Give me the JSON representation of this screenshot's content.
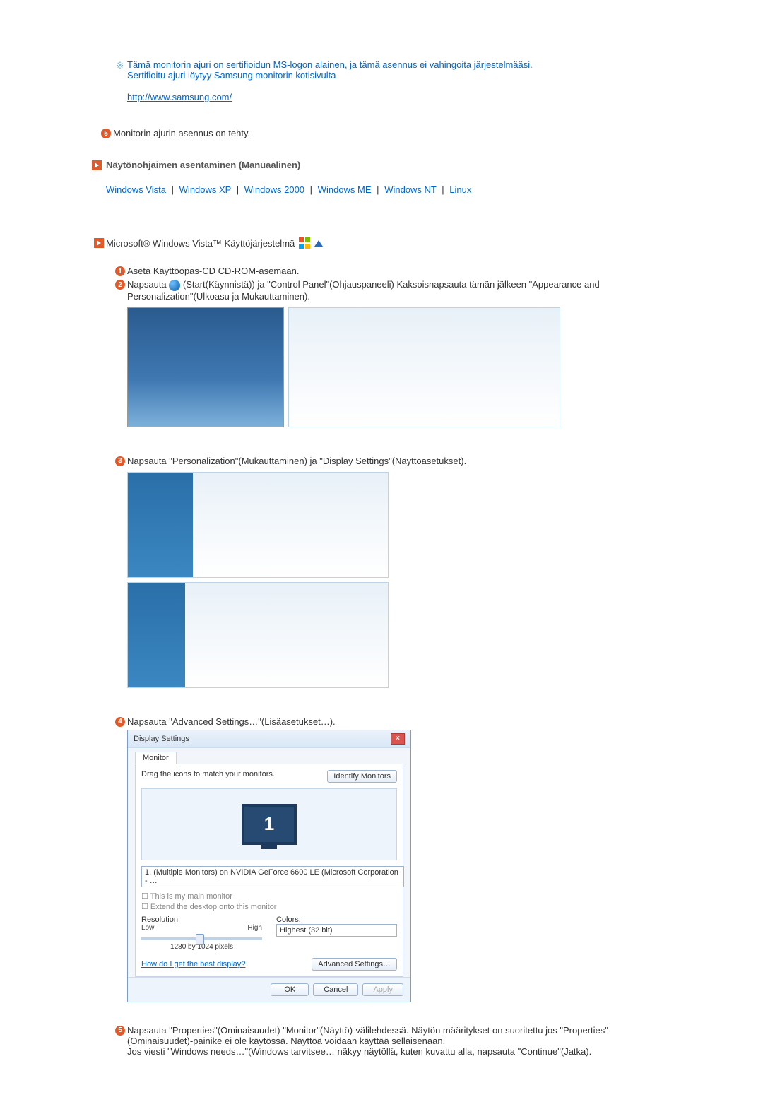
{
  "note": {
    "line1": "Tämä monitorin ajuri on sertifioidun MS-logon alainen, ja tämä asennus ei vahingoita järjestelmääsi.",
    "line2": "Sertifioitu ajuri löytyy Samsung monitorin kotisivulta",
    "url": "http://www.samsung.com/"
  },
  "step5": "Monitorin ajurin asennus on tehty.",
  "manual_heading": "Näytönohjaimen asentaminen (Manuaalinen)",
  "os_links": {
    "vista": "Windows Vista",
    "xp": "Windows XP",
    "w2000": "Windows 2000",
    "me": "Windows ME",
    "nt": "Windows NT",
    "linux": "Linux",
    "sep": "|"
  },
  "vista_heading": "Microsoft® Windows Vista™ Käyttöjärjestelmä",
  "vista_step1": "Aseta Käyttöopas-CD CD-ROM-asemaan.",
  "vista_step2": "Napsauta (Start(Käynnistä)) ja \"Control Panel\"(Ohjauspaneeli) Kaksoisnapsauta tämän jälkeen \"Appearance and Personalization\"(Ulkoasu ja Mukauttaminen).",
  "vista_step3": "Napsauta \"Personalization\"(Mukauttaminen) ja \"Display Settings\"(Näyttöasetukset).",
  "vista_step4": "Napsauta \"Advanced Settings…\"(Lisäasetukset…).",
  "vista_step5": "Napsauta \"Properties\"(Ominaisuudet) \"Monitor\"(Näyttö)-välilehdessä. Näytön määritykset on suoritettu jos \"Properties\"(Ominaisuudet)-painike ei ole käytössä. Näyttöä voidaan käyttää sellaisenaan.",
  "vista_step5b": "Jos viesti \"Windows needs…\"(Windows tarvitsee… näkyy näytöllä, kuten kuvattu alla, napsauta \"Continue\"(Jatka).",
  "display_settings": {
    "title": "Display Settings",
    "tab": "Monitor",
    "drag_text": "Drag the icons to match your monitors.",
    "identify_btn": "Identify Monitors",
    "monitor_num": "1",
    "monitor_select": "1. (Multiple Monitors) on NVIDIA GeForce 6600 LE (Microsoft Corporation - …",
    "chk_main": "This is my main monitor",
    "chk_extend": "Extend the desktop onto this monitor",
    "resolution_label": "Resolution:",
    "low": "Low",
    "high": "High",
    "res_value": "1280 by 1024 pixels",
    "colors_label": "Colors:",
    "colors_value": "Highest (32 bit)",
    "best_display": "How do I get the best display?",
    "adv_btn": "Advanced Settings…",
    "ok": "OK",
    "cancel": "Cancel",
    "apply": "Apply"
  }
}
